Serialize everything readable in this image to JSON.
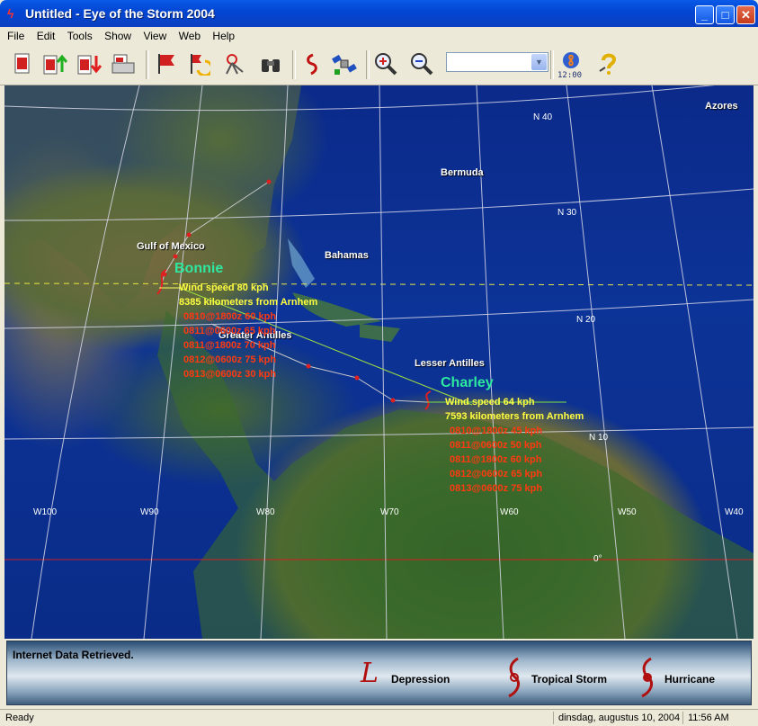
{
  "window": {
    "title": "Untitled - Eye of the Storm 2004"
  },
  "menu": [
    "File",
    "Edit",
    "Tools",
    "Show",
    "View",
    "Web",
    "Help"
  ],
  "toolbar": {
    "clock_label": "12:00",
    "icons": [
      "new-doc-icon",
      "upload-icon",
      "download-icon",
      "print-icon",
      "flag-icon",
      "refresh-icon",
      "antenna-icon",
      "binoculars-icon",
      "storm-icon",
      "satellite-icon",
      "zoom-in-icon",
      "zoom-out-icon"
    ]
  },
  "map": {
    "places": {
      "azores": "Azores",
      "bermuda": "Bermuda",
      "gulf": "Gulf of Mexico",
      "bahamas": "Bahamas",
      "greater_antilles": "Greater Antilles",
      "lesser_antilles": "Lesser Antilles"
    },
    "lat_labels": [
      "N 40",
      "N 30",
      "N 20",
      "N 10",
      "0°"
    ],
    "lon_labels": [
      "W100",
      "W90",
      "W80",
      "W70",
      "W60",
      "W50",
      "W40"
    ],
    "storms": [
      {
        "name": "Bonnie",
        "wind": "Wind speed 80 kph",
        "distance": "8385 kilometers from Arnhem",
        "forecasts": [
          "0810@1800z 60 kph",
          "0811@0600z 65 kph",
          "0811@1800z 70 kph",
          "0812@0600z 75 kph",
          "0813@0600z 30 kph"
        ]
      },
      {
        "name": "Charley",
        "wind": "Wind speed 64 kph",
        "distance": "7593 kilometers from Arnhem",
        "forecasts": [
          "0810@1800z 45 kph",
          "0811@0600z 50 kph",
          "0811@1800z 60 kph",
          "0812@0600z 65 kph",
          "0813@0600z 75 kph"
        ]
      }
    ]
  },
  "legend": {
    "message": "Internet Data Retrieved.",
    "depression": "Depression",
    "tropical_storm": "Tropical Storm",
    "hurricane": "Hurricane"
  },
  "status": {
    "left": "Ready",
    "date": "dinsdag, augustus 10, 2004",
    "time": "11:56 AM"
  },
  "colors": {
    "storm_name": "#2ee8a0",
    "storm_info": "#ffff40",
    "forecast": "#ff3a10",
    "track": "#c8c8c8"
  }
}
